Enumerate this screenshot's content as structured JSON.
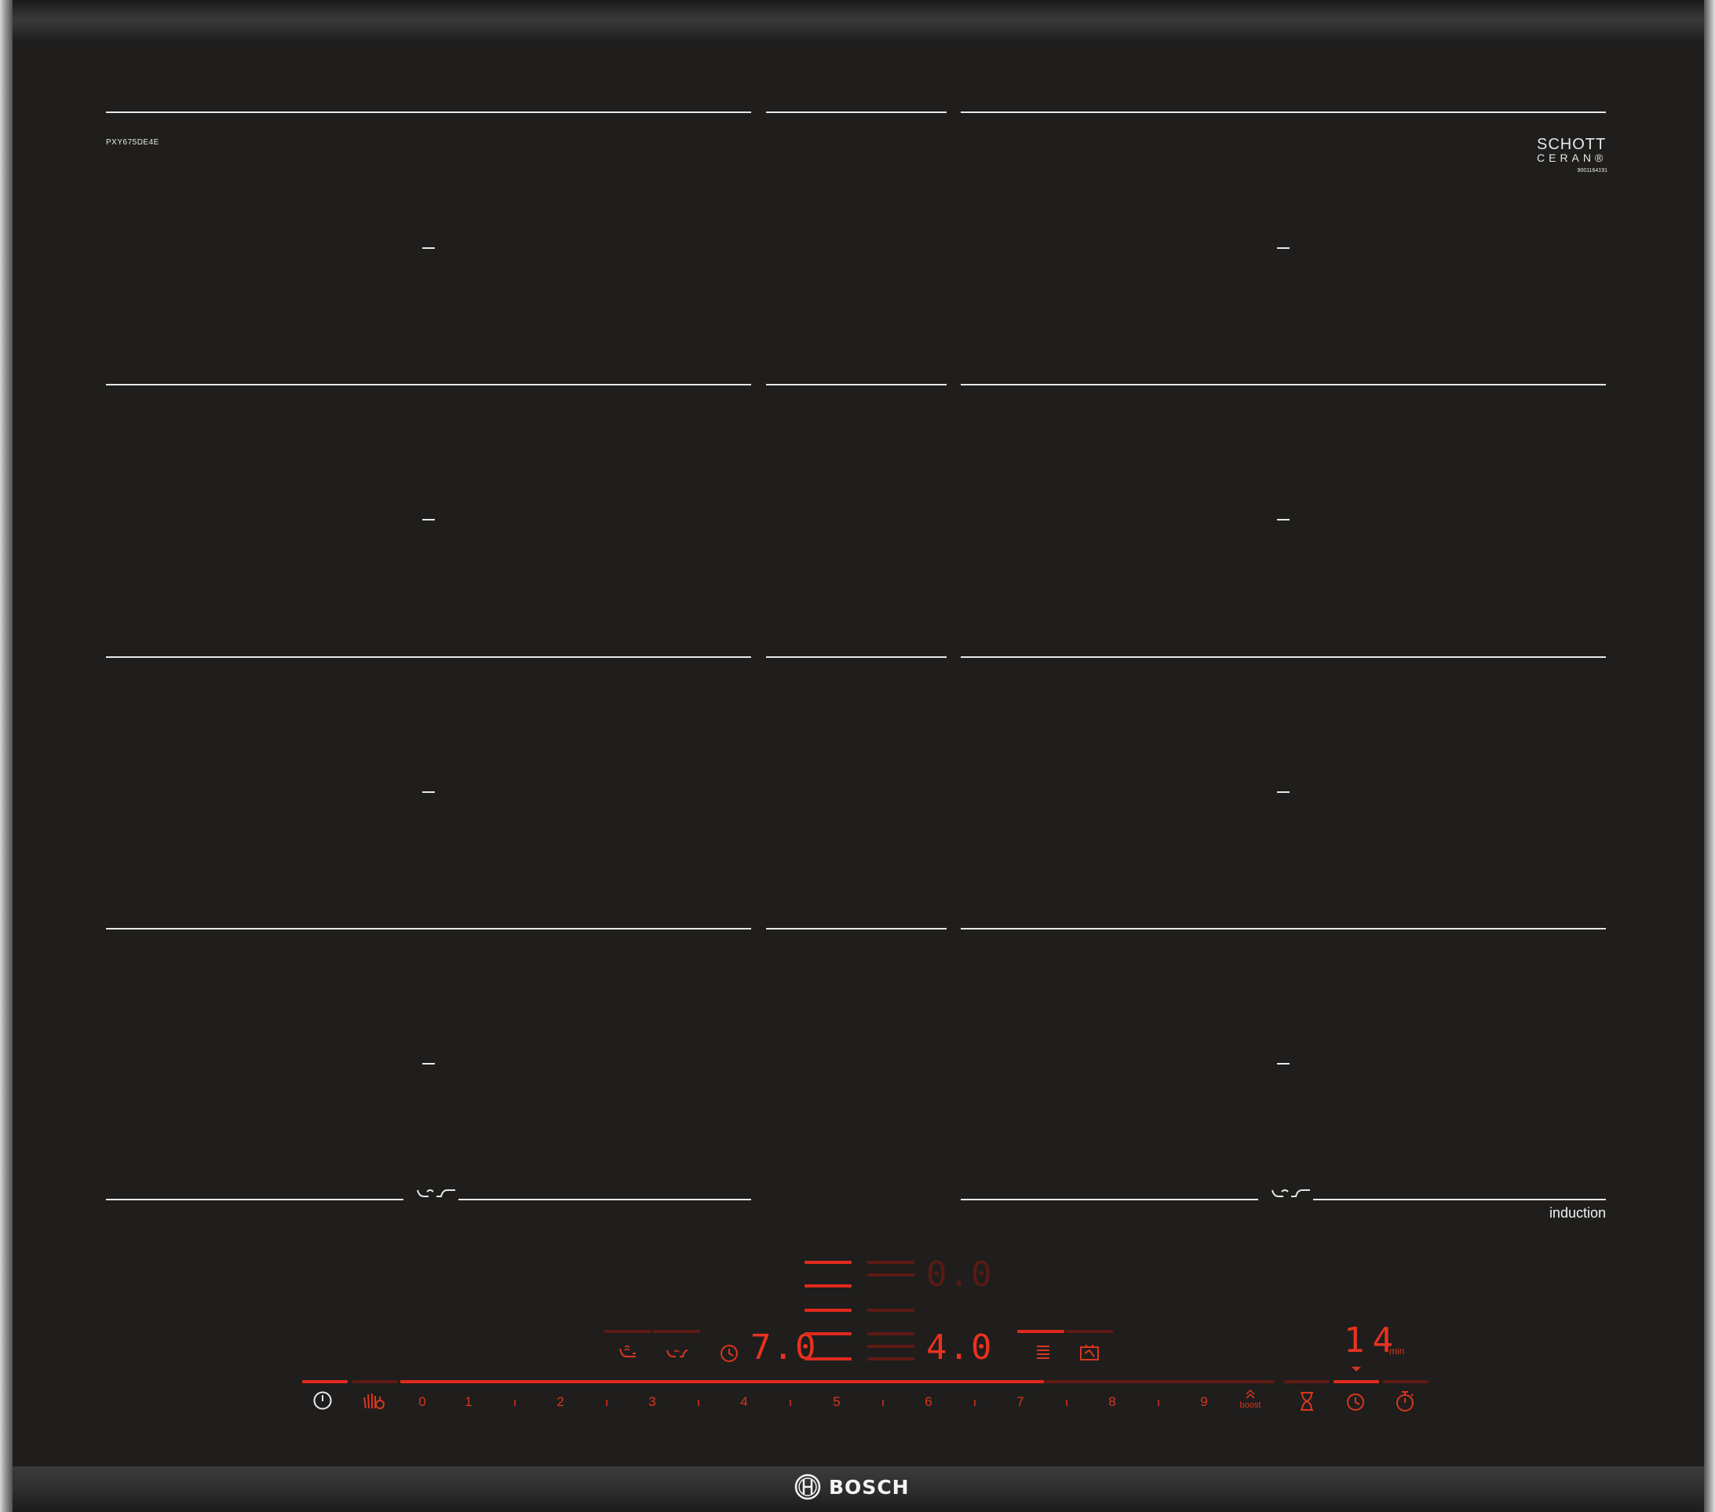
{
  "model": "PXY675DE4E",
  "glass_brand": {
    "line1": "SCHOTT",
    "line2": "CERAN®",
    "code": "9001164191"
  },
  "induction_label": "induction",
  "brand": "BOSCH",
  "displays": {
    "top": "0.0",
    "left": "7.0",
    "right": "4.0",
    "timer": "14",
    "timer_unit": "min"
  },
  "power_scale": [
    "0",
    "1",
    "2",
    "3",
    "4",
    "5",
    "6",
    "7",
    "8",
    "9"
  ],
  "boost_label": "boost",
  "selected_power_level": 7,
  "icons": {
    "power": "power-icon",
    "child_lock": "child-lock-icon",
    "flex_zone": "flex-zone-wave-icon",
    "move_function": "move-function-icon",
    "timer": "timer-icon",
    "menu": "menu-icon",
    "frying_sensor": "frying-sensor-icon",
    "kitchen_timer": "kitchen-timer-icon",
    "stopwatch": "stopwatch-icon",
    "pan_boost": "pan-boost-icon"
  },
  "colors": {
    "glass": "#1f1e1c",
    "lines": "#e8e8e8",
    "led_active": "#e02a1c",
    "led_dim": "#5e1a14"
  }
}
